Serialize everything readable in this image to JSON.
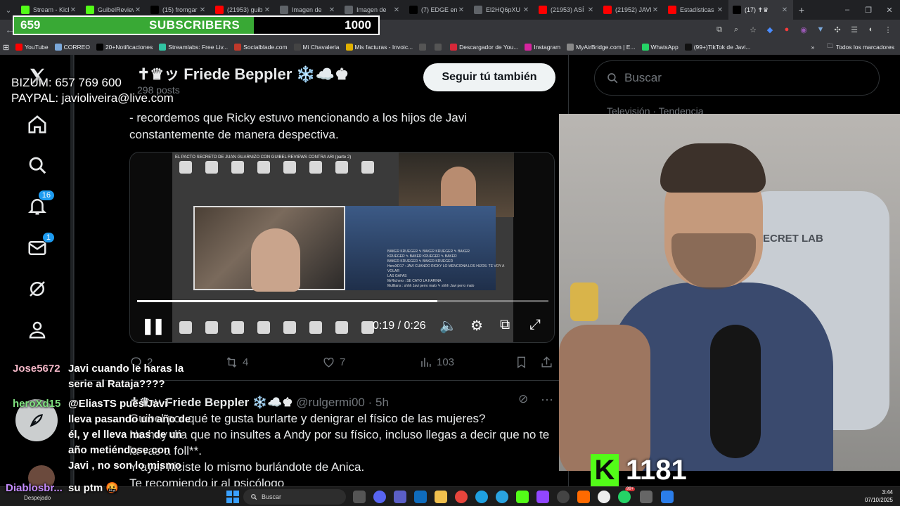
{
  "browser": {
    "tabs": [
      {
        "title": "Stream - Kick",
        "favicon": "kick-icon",
        "color": "#53fc18"
      },
      {
        "title": "GuibelReviews",
        "favicon": "kick-icon",
        "color": "#53fc18"
      },
      {
        "title": "(15) fromgar",
        "favicon": "x-icon",
        "color": "#000000"
      },
      {
        "title": "(21953) guib",
        "favicon": "youtube-icon",
        "color": "#ff0000"
      },
      {
        "title": "Imagen de",
        "favicon": "globe-icon",
        "color": "#5f6368"
      },
      {
        "title": "Imagen de",
        "favicon": "globe-icon",
        "color": "#5f6368"
      },
      {
        "title": "(7) EDGE en",
        "favicon": "x-icon",
        "color": "#000000"
      },
      {
        "title": "El2HQ6pXU",
        "favicon": "globe-icon",
        "color": "#5f6368"
      },
      {
        "title": "(21953) ASÍ",
        "favicon": "youtube-icon",
        "color": "#ff0000"
      },
      {
        "title": "(21952) JAVI",
        "favicon": "youtube-icon",
        "color": "#ff0000"
      },
      {
        "title": "Estadísticas",
        "favicon": "youtube-studio-icon",
        "color": "#ff0000"
      },
      {
        "title": "(17) ✝♛",
        "favicon": "x-icon",
        "color": "#000000",
        "active": true
      }
    ],
    "bookmarks": [
      {
        "label": "YouTube",
        "color": "#ff0000"
      },
      {
        "label": "CORREO",
        "color": "#7aa7d9"
      },
      {
        "label": "20+Notificaciones",
        "color": "#000000"
      },
      {
        "label": "Streamlabs: Free Liv...",
        "color": "#31c3a2"
      },
      {
        "label": "Socialblade.com",
        "color": "#c0392b"
      },
      {
        "label": "Mi Chavaleria",
        "color": "#444444"
      },
      {
        "label": "Mis facturas - Invoic...",
        "color": "#e0b000"
      },
      {
        "label": "",
        "color": "#555555"
      },
      {
        "label": "",
        "color": "#555555"
      },
      {
        "label": "Descargador de You...",
        "color": "#d62839"
      },
      {
        "label": "Instagram",
        "color": "#d6249f"
      },
      {
        "label": "MyAirBridge.com | E...",
        "color": "#888888"
      },
      {
        "label": "WhatsApp",
        "color": "#25d366"
      },
      {
        "label": "(99+)TikTok de Javi...",
        "color": "#111111"
      }
    ],
    "bookmarks_more": "»",
    "all_bookmarks": "Todos los marcadores"
  },
  "overlay": {
    "subs_current": "659",
    "subs_label": "SUBSCRIBERS",
    "subs_goal": "1000",
    "subs_fraction": 0.659,
    "bizum": "BIZUM: 657 769 600",
    "paypal": "PAYPAL: javioliveira@live.com",
    "kick_count": "1181",
    "kick_letter": "K"
  },
  "profile": {
    "name": "✝♛ッ Friede Beppler ❄️☁️♚",
    "posts": "298 posts",
    "follow_label": "Seguir tú también"
  },
  "nav": {
    "notifications_badge": "16",
    "messages_badge": "1"
  },
  "tweet1": {
    "text": "- recordemos que Ricky estuvo mencionando a los hijos de Javi constantemente de manera despectiva.",
    "video_title": "EL PACTO SECRETO DE JUAN GUARNIZO CON GUIBEL REVIEWS CONTRA ARI (parte 2)",
    "video_time": "0:19 / 0:26",
    "video_progress": 0.73,
    "replies": "2",
    "reposts": "4",
    "likes": "7",
    "views": "103",
    "chat_lines": [
      "BAKER KRUEGER ✎ BAKER KRUEGER ✎ BAKER",
      "KRUEGER ✎ BAKER KRUEGER ✎ BAKER",
      "BAKER KRUEGER ✎ BAKER KRUEGER",
      "HeroXD17 : JAVI CUANDO RICKY LO MENCIONA LOS HIJOS: TE VOY A VOLAR",
      "LAS GAFAS",
      "MrRichero : SE CAYO LA HARINA",
      "Mulllians : shhh Javi perro malo ✎ shhh Javi perro malo"
    ]
  },
  "tweet2": {
    "name": "✝♛ッ Friede Beppler ❄️☁️♚",
    "handle": "@rulgermi00",
    "time": "5h",
    "lines": [
      "Guibel por qué te gusta burlarte y denigrar el físico de las mujeres?",
      "No hay día que no insultes a Andy por su físico, incluso llegas a decir que no te la vas a foll**.",
      "Y ayer hiciste lo mismo burlándote de Anica.",
      "Te recomiendo ir al psicólogo"
    ]
  },
  "sidebar": {
    "search_placeholder": "Buscar",
    "trend_meta": "Televisión · Tendencia"
  },
  "webcam": {
    "chair_brand": "SECRET LAB"
  },
  "chat": [
    {
      "user": "Jose5672",
      "color": "#f2b6c6",
      "text": "Javi cuando le haras la serie al Rataja????"
    },
    {
      "user": "heroXd15",
      "color": "#7fe07f",
      "text": "@EliasTS pues Javi lleva pasando un año de él, y el lleva mas de un año metiéndose con Javi , no son lo mismo"
    },
    {
      "user": "Diablosbr...",
      "color": "#c58cff",
      "text": "su ptm 🤬"
    }
  ],
  "weather_label": "Despejado",
  "taskbar": {
    "search": "Buscar",
    "time": "3:44",
    "date": "07/10/2025",
    "badge": "99+"
  }
}
